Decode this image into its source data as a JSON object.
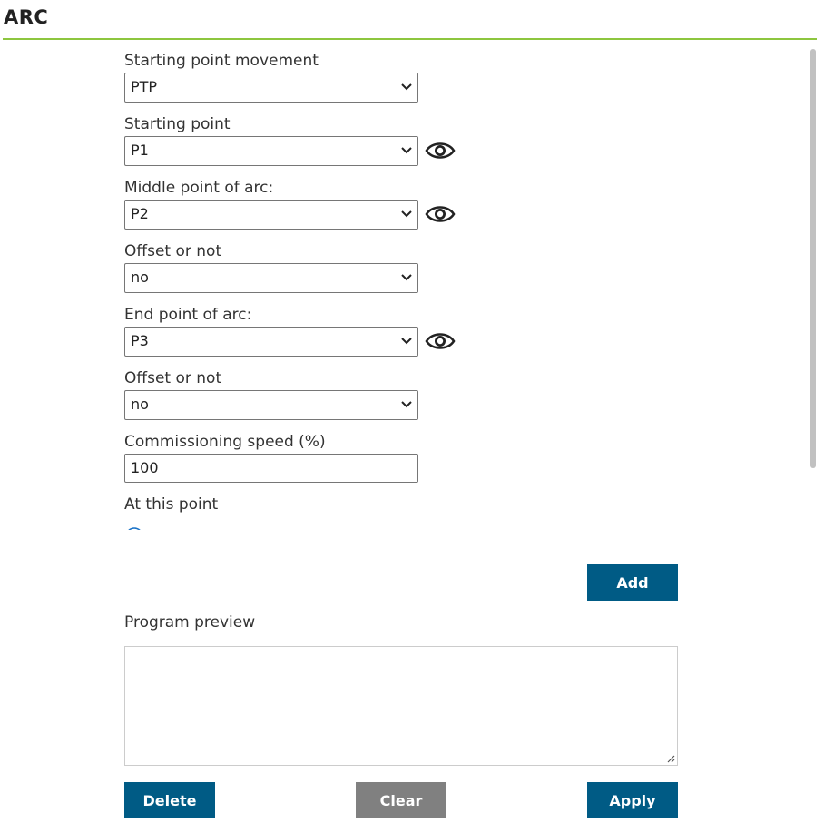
{
  "header": {
    "title": "ARC"
  },
  "form": {
    "starting_point_movement": {
      "label": "Starting point movement",
      "value": "PTP"
    },
    "starting_point": {
      "label": "Starting point",
      "value": "P1"
    },
    "middle_point": {
      "label": "Middle point of arc:",
      "value": "P2"
    },
    "middle_offset": {
      "label": "Offset or not",
      "value": "no"
    },
    "end_point": {
      "label": "End point of arc:",
      "value": "P3"
    },
    "end_offset": {
      "label": "Offset or not",
      "value": "no"
    },
    "speed": {
      "label": "Commissioning speed (%)",
      "value": "100"
    },
    "at_this_point": {
      "label": "At this point"
    }
  },
  "buttons": {
    "add": "Add",
    "delete": "Delete",
    "clear": "Clear",
    "apply": "Apply"
  },
  "preview": {
    "label": "Program preview",
    "value": ""
  },
  "icons": {
    "eye": "eye-icon",
    "chevron": "chevron-down-icon"
  },
  "colors": {
    "accent_rule": "#8dc63f",
    "primary_button": "#005b85",
    "secondary_button": "#808080"
  }
}
